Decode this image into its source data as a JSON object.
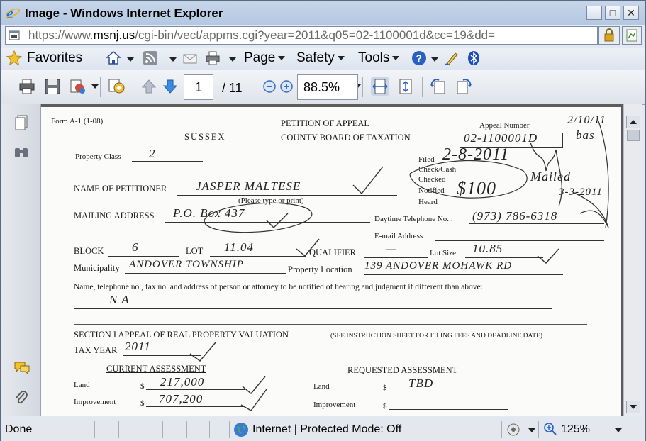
{
  "window": {
    "title": "Image - Windows Internet Explorer",
    "minimize_label": "_",
    "maximize_label": "□",
    "close_label": "✕"
  },
  "address": {
    "url_scheme": "https://www.",
    "url_host": "msnj.us",
    "url_path": "/cgi-bin/vect/appms.cgi?year=2011&q05=02-1100001d&cc=19&dd="
  },
  "commandbar": {
    "favorites": "Favorites",
    "page": "Page",
    "safety": "Safety",
    "tools": "Tools"
  },
  "pdf_toolbar": {
    "page_current": "1",
    "page_total": "/ 11",
    "zoom": "88.5%"
  },
  "document": {
    "form_id": "Form A-1 (1-08)",
    "title1": "PETITION OF APPEAL",
    "title2": "COUNTY BOARD OF TAXATION",
    "county": "SUSSEX",
    "appeal_number_label": "Appeal Number",
    "appeal_number_value": "02-1100001D",
    "date_hw": "2/10/11",
    "initials_hw": "bas",
    "property_class_label": "Property Class",
    "property_class_value": "2",
    "filed_label": "Filed",
    "filed_value": "2-8-2011",
    "check_cash_label": "Check/Cash",
    "checked_label": "Checked",
    "notified_label": "Notified",
    "heard_label": "Heard",
    "amount_hw": "$100",
    "mailed_hw": "Mailed",
    "date2_hw": "3-3-2011",
    "petitioner_label": "NAME OF PETITIONER",
    "petitioner_value": "JASPER MALTESE",
    "please_type": "(Please type or print)",
    "mailing_label": "MAILING ADDRESS",
    "mailing_value": "P.O. Box 437",
    "daytime_phone_label": "Daytime Telephone No. :",
    "daytime_phone_value": "(973) 786-6318",
    "email_label": "E-mail Address",
    "block_label": "BLOCK",
    "block_value": "6",
    "lot_label": "LOT",
    "lot_value": "11.04",
    "qualifier_label": "QUALIFIER",
    "qualifier_value": "—",
    "lot_size_label": "Lot Size",
    "lot_size_value": "10.85",
    "municipality_label": "Municipality",
    "municipality_value": "ANDOVER TOWNSHIP",
    "property_location_label": "Property Location",
    "property_location_value": "139 ANDOVER MOHAWK RD",
    "notify_label": "Name, telephone no., fax no. and address of person or attorney to be notified of hearing and judgment if different than above:",
    "notify_value": "N A",
    "section_label": "SECTION I   APPEAL OF REAL PROPERTY VALUATION",
    "section_note": "(SEE INSTRUCTION SHEET FOR FILING FEES AND DEADLINE DATE)",
    "tax_year_label": "TAX YEAR",
    "tax_year_value": "2011",
    "current_assessment": "CURRENT ASSESSMENT",
    "requested_assessment": "REQUESTED ASSESSMENT",
    "land_label": "Land",
    "improvement_label": "Improvement",
    "dollar": "$",
    "current_land": "217,000",
    "current_improvement": "707,200",
    "requested_land": "TBD"
  },
  "status": {
    "done": "Done",
    "zone": "Internet | Protected Mode: Off",
    "zoom": "125%"
  },
  "colors": {
    "ie_blue": "#1e6fd6",
    "title_gradient_top": "#c7d6ea",
    "doc_background": "#5c5c5c"
  }
}
